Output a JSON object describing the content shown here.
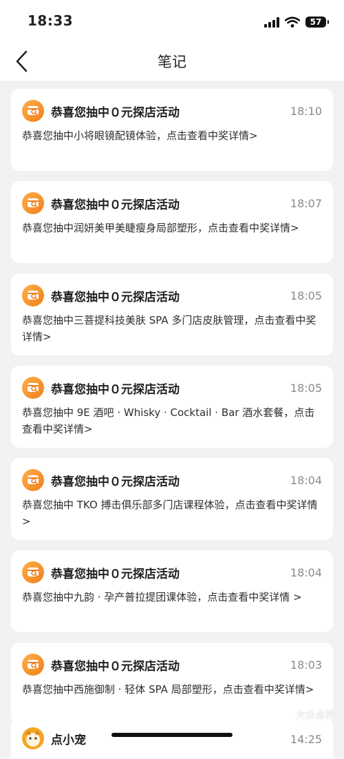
{
  "status_bar": {
    "time": "18:33",
    "battery": "57"
  },
  "header": {
    "title": "笔记"
  },
  "notifications": [
    {
      "title": "恭喜您抽中０元探店活动",
      "time": "18:10",
      "body": "恭喜您抽中小将眼镜配镜体验，点击查看中奖详情>"
    },
    {
      "title": "恭喜您抽中０元探店活动",
      "time": "18:07",
      "body": "恭喜您抽中润妍美甲美睫瘦身局部塑形，点击查看中奖详情>"
    },
    {
      "title": "恭喜您抽中０元探店活动",
      "time": "18:05",
      "body": "恭喜您抽中三菩提科技美肤 SPA 多门店皮肤管理，点击查看中奖详情>"
    },
    {
      "title": "恭喜您抽中０元探店活动",
      "time": "18:05",
      "body": "恭喜您抽中 9E 酒吧 · Whisky · Cocktail · Bar 酒水套餐，点击查看中奖详情>"
    },
    {
      "title": "恭喜您抽中０元探店活动",
      "time": "18:04",
      "body": "恭喜您抽中 TKO 搏击俱乐部多门店课程体验，点击查看中奖详情>"
    },
    {
      "title": "恭喜您抽中０元探店活动",
      "time": "18:04",
      "body": "恭喜您抽中九韵 · 孕产普拉提团课体验，点击查看中奖详情 >"
    },
    {
      "title": "恭喜您抽中０元探店活动",
      "time": "18:03",
      "body": "恭喜您抽中西施御制 · 轻体 SPA 局部塑形，点击查看中奖详情>"
    }
  ],
  "partial_item": {
    "name": "点小宠",
    "time": "14:25"
  },
  "watermark": "大众点评"
}
